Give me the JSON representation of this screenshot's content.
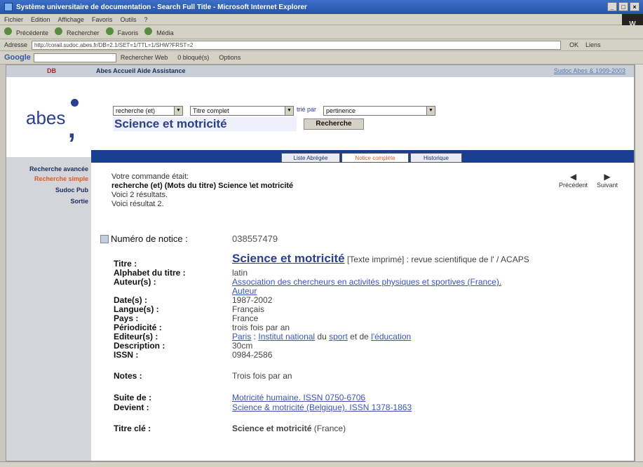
{
  "window": {
    "title": "Système universitaire de documentation - Search Full Title - Microsoft Internet Explorer",
    "brand": "W"
  },
  "menu": [
    "Fichier",
    "Edition",
    "Affichage",
    "Favoris",
    "Outils",
    "?"
  ],
  "toolbar": {
    "back": "Précédente",
    "search": "Rechercher",
    "favorites": "Favoris",
    "media": "Média"
  },
  "address": {
    "label": "Adresse",
    "url": "http://corail.sudoc.abes.fr/DB=2.1/SET=1/TTL=1/SHW?FRST=2",
    "go": "OK",
    "links": "Liens"
  },
  "google": {
    "logo": "Google",
    "search_web": "Rechercher Web",
    "blocked": "0 bloqué(s)",
    "options": "Options"
  },
  "topnav": {
    "left": "DB",
    "links": "Abes Accueil Aide Assistance",
    "right": "Sudoc Abes & 1999-2003"
  },
  "logo": {
    "text": "abes"
  },
  "search": {
    "mode": "recherche (et)",
    "field": "Titre complet",
    "sort_label": "trié par",
    "sort": "pertinence",
    "query": "Science et motricité",
    "button": "Recherche"
  },
  "sidebar": [
    "Recherche avancée",
    "Recherche simple",
    "Sudoc Pub",
    "Sortie"
  ],
  "tabs": [
    "Liste Abrégée",
    "Notice complète",
    "Historique"
  ],
  "command": {
    "line1": "Votre commande était:",
    "line2": "recherche (et) (Mots du titre) Science \\et motricité",
    "line3": "Voici 2 résultats.",
    "line4": "Voici résultat 2."
  },
  "navigation": {
    "prev": "Précédent",
    "next": "Suivant"
  },
  "notice": {
    "number_label": "Numéro de notice :",
    "number": "038557479",
    "titre_label": "Titre :",
    "titre": "Science et motricité",
    "titre_rest": "[Texte imprimé] : revue scientifique de l' / ACAPS",
    "alphabet_label": "Alphabet du titre :",
    "alphabet": "latin",
    "auteur_label": "Auteur(s) :",
    "auteur": "Association des chercheurs en activités physiques et sportives (France).",
    "auteur_role": "Auteur",
    "dates_label": "Date(s) :",
    "dates": "1987-2002",
    "langue_label": "Langue(s) :",
    "langue": "Français",
    "pays_label": "Pays :",
    "pays": "France",
    "periodicite_label": "Périodicité :",
    "periodicite": "trois fois par an",
    "editeur_label": "Editeur(s) :",
    "editeur_1": "Paris",
    "editeur_2": "Institut national",
    "editeur_3": "du",
    "editeur_4": "sport",
    "editeur_5": "et de",
    "editeur_6": "l'éducation",
    "description_label": "Description :",
    "description": "30cm",
    "issn_label": "ISSN :",
    "issn": "0984-2586",
    "notes_label": "Notes :",
    "notes": "Trois fois par an",
    "suite_label": "Suite de :",
    "suite": "Motricité humaine. ISSN 0750-6706",
    "devient_label": "Devient :",
    "devient": "Science & motricité (Belgique). ISSN 1378-1863",
    "titrecle_label": "Titre clé :",
    "titrecle": "Science et motricité",
    "titrecle_rest": "(France)"
  }
}
